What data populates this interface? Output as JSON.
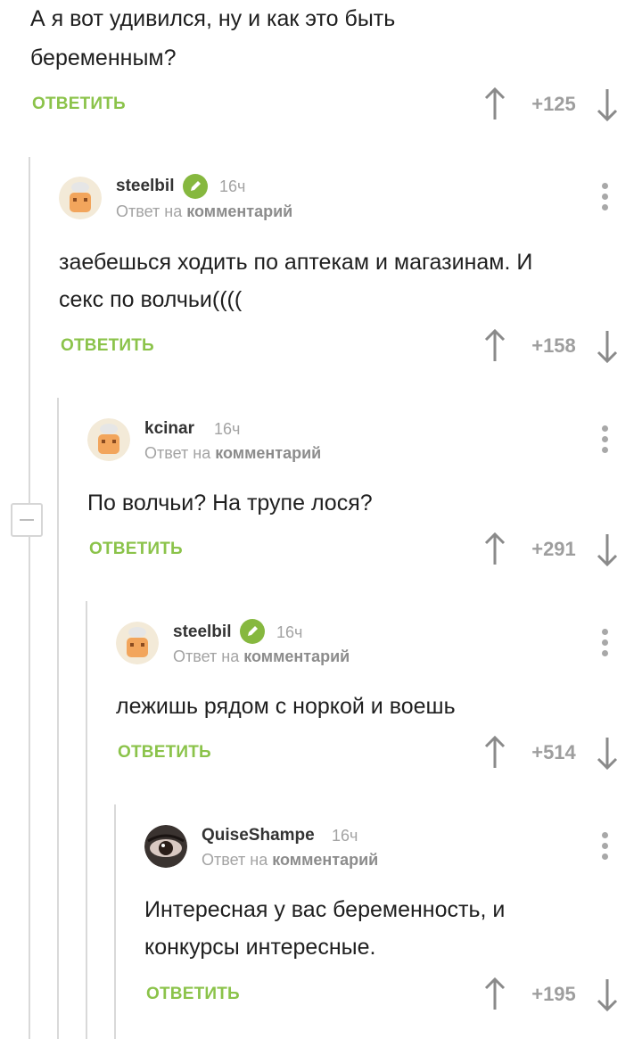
{
  "comments": [
    {
      "text_lines": [
        "А  я вот удивился, ну и как это быть",
        "беременным?"
      ],
      "reply_label": "ОТВЕТИТЬ",
      "score": "+125"
    },
    {
      "username": "steelbil",
      "time": "16ч",
      "reply_prefix": "Ответ на",
      "reply_link": "комментарий",
      "text_lines": [
        "заебешься ходить по аптекам  и магазинам. И",
        "секс по волчьи(((("
      ],
      "reply_label": "ОТВЕТИТЬ",
      "score": "+158"
    },
    {
      "username": "kcinar",
      "time": "16ч",
      "reply_prefix": "Ответ на",
      "reply_link": "комментарий",
      "text_lines": [
        "По волчьи? На трупе лося?"
      ],
      "reply_label": "ОТВЕТИТЬ",
      "score": "+291"
    },
    {
      "username": "steelbil",
      "time": "16ч",
      "reply_prefix": "Ответ на",
      "reply_link": "комментарий",
      "text_lines": [
        "лежишь рядом с норкой и воешь"
      ],
      "reply_label": "ОТВЕТИТЬ",
      "score": "+514"
    },
    {
      "username": "QuiseShampe",
      "time": "16ч",
      "reply_prefix": "Ответ на",
      "reply_link": "комментарий",
      "text_lines": [
        "Интересная у вас беременность, и",
        "конкурсы интересные."
      ],
      "reply_label": "ОТВЕТИТЬ",
      "score": "+195"
    }
  ],
  "icons": {
    "upvote": "arrow-up-icon",
    "downvote": "arrow-down-icon",
    "menu": "more-vertical-icon",
    "verified": "pencil-badge-icon",
    "collapse": "minus-icon"
  },
  "colors": {
    "accent_green": "#8bc34a",
    "badge_green": "#86b83f",
    "muted_gray": "#9e9e9e",
    "thread_line": "#d9d9d9"
  }
}
